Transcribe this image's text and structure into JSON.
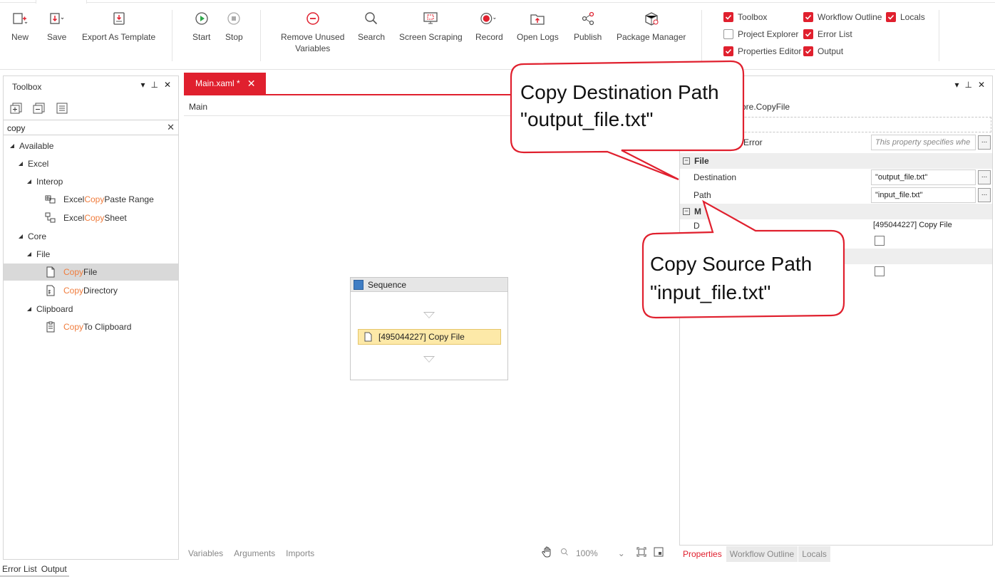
{
  "ribbon": {
    "buttons": [
      {
        "name": "new-button",
        "icon": "new-file-icon",
        "label": "New"
      },
      {
        "name": "save-button",
        "icon": "save-icon",
        "label": "Save"
      },
      {
        "name": "export-template-button",
        "icon": "export-template-icon",
        "label": "Export As Template"
      },
      {
        "name": "start-button",
        "icon": "play-icon",
        "label": "Start"
      },
      {
        "name": "stop-button",
        "icon": "stop-icon",
        "label": "Stop"
      },
      {
        "name": "remove-unused-variables-button",
        "icon": "remove-icon",
        "label_line1": "Remove Unused",
        "label_line2": "Variables"
      },
      {
        "name": "search-button",
        "icon": "search-icon",
        "label": "Search"
      },
      {
        "name": "screen-scraping-button",
        "icon": "screen-scraping-icon",
        "label": "Screen Scraping"
      },
      {
        "name": "record-button",
        "icon": "record-icon",
        "label": "Record"
      },
      {
        "name": "open-logs-button",
        "icon": "open-logs-icon",
        "label": "Open Logs"
      },
      {
        "name": "publish-button",
        "icon": "publish-icon",
        "label": "Publish"
      },
      {
        "name": "package-manager-button",
        "icon": "package-icon",
        "label": "Package Manager"
      }
    ],
    "panels": [
      {
        "label": "Toolbox",
        "checked": true
      },
      {
        "label": "Workflow Outline",
        "checked": true
      },
      {
        "label": "Locals",
        "checked": true
      },
      {
        "label": "Project Explorer",
        "checked": false
      },
      {
        "label": "Error List",
        "checked": true
      },
      {
        "label": "Properties Editor",
        "checked": true
      },
      {
        "label": "Output",
        "checked": true
      }
    ]
  },
  "toolbox": {
    "title": "Toolbox",
    "search_value": "copy",
    "tree": {
      "available": "Available",
      "excel": "Excel",
      "interop": "Interop",
      "excel_copy_paste_range": {
        "pre": "Excel ",
        "hl": "Copy",
        "post": " Paste Range"
      },
      "excel_copy_sheet": {
        "pre": "Excel ",
        "hl": "Copy",
        "post": " Sheet"
      },
      "core": "Core",
      "file": "File",
      "copy_file": {
        "hl": "Copy",
        "post": " File"
      },
      "copy_directory": {
        "hl": "Copy",
        "post": " Directory"
      },
      "clipboard": "Clipboard",
      "copy_to_clipboard": {
        "hl": "Copy",
        "post": " To Clipboard"
      }
    }
  },
  "designer": {
    "tab_label": "Main.xaml *",
    "breadcrumb": "Main",
    "sequence_title": "Sequence",
    "activity_label": "[495044227] Copy File",
    "footer_tabs": [
      "Variables",
      "Arguments",
      "Imports"
    ],
    "zoom": "100%"
  },
  "properties": {
    "type_name": "ore.CopyFile",
    "continue_on_error_label": "Error",
    "continue_on_error_placeholder": "This property specifies whe",
    "category_file": "File",
    "destination_label": "Destination",
    "destination_value": "\"output_file.txt\"",
    "path_label": "Path",
    "path_value": "\"input_file.txt\"",
    "category_misc": "M",
    "display_name_label": "D",
    "display_name_value": "[495044227] Copy File",
    "footer_tabs": [
      "Properties",
      "Workflow Outline",
      "Locals"
    ]
  },
  "bottom_tabs": [
    "Error List",
    "Output"
  ],
  "callouts": {
    "destination_line1": "Copy Destination Path",
    "destination_line2": "\"output_file.txt\"",
    "source_line1": "Copy Source Path",
    "source_line2": "\"input_file.txt\""
  },
  "colors": {
    "accent": "#e0202e",
    "highlight_text": "#f07c3c",
    "activity_fill": "#fde9a8"
  }
}
